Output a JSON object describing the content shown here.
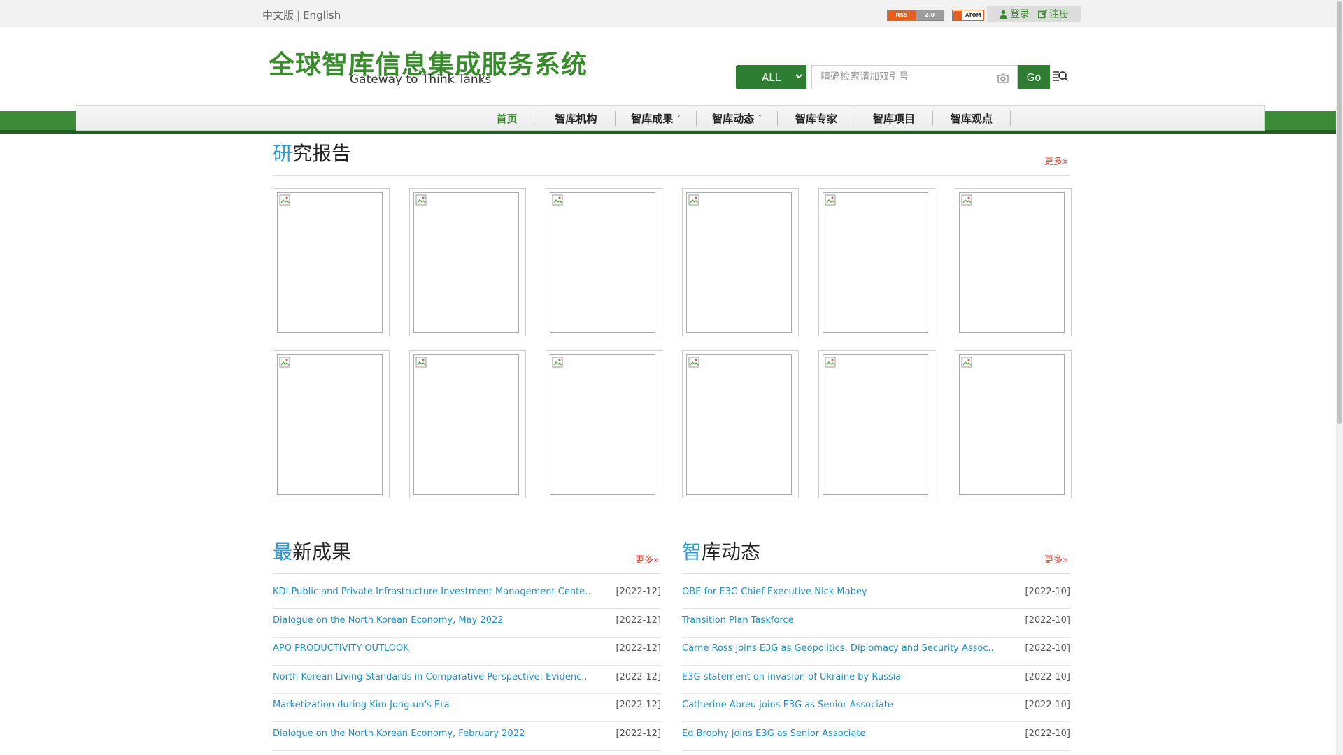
{
  "topbar": {
    "lang_cn": "中文版",
    "lang_sep": "|",
    "lang_en": "English",
    "rss_left": "RSS",
    "rss_right": "2.0",
    "atom_label": "ATOM",
    "login_label": "登录",
    "register_label": "注册"
  },
  "header": {
    "logo_cn": "全球智库信息集成服务系统",
    "logo_en": "Gateway to Think Tanks",
    "search": {
      "scope_value": "ALL",
      "placeholder": "精确检索请加双引号",
      "go_label": "Go"
    }
  },
  "nav": {
    "items": [
      {
        "label": "首页",
        "active": true,
        "dropdown": false
      },
      {
        "label": "智库机构",
        "active": false,
        "dropdown": false
      },
      {
        "label": "智库成果",
        "active": false,
        "dropdown": true
      },
      {
        "label": "智库动态",
        "active": false,
        "dropdown": true
      },
      {
        "label": "智库专家",
        "active": false,
        "dropdown": false
      },
      {
        "label": "智库项目",
        "active": false,
        "dropdown": false
      },
      {
        "label": "智库观点",
        "active": false,
        "dropdown": false
      }
    ],
    "caret": "˅"
  },
  "reports": {
    "title_first": "研",
    "title_rest": "究报告",
    "more": "更多»"
  },
  "latest": {
    "title_first": "最",
    "title_rest": "新成果",
    "more": "更多»",
    "items": [
      {
        "title": "KDI Public and Private Infrastructure Investment Management Cente..",
        "date": "[2022-12]"
      },
      {
        "title": "Dialogue on the North Korean Economy, May 2022",
        "date": "[2022-12]"
      },
      {
        "title": "APO PRODUCTIVITY OUTLOOK",
        "date": "[2022-12]"
      },
      {
        "title": "North Korean Living Standards in Comparative Perspective: Evidenc..",
        "date": "[2022-12]"
      },
      {
        "title": "Marketization during Kim Jong-un's Era",
        "date": "[2022-12]"
      },
      {
        "title": "Dialogue on the North Korean Economy, February 2022",
        "date": "[2022-12]"
      }
    ]
  },
  "dynamics": {
    "title_first": "智",
    "title_rest": "库动态",
    "more": "更多»",
    "items": [
      {
        "title": "OBE for E3G Chief Executive Nick Mabey",
        "date": "[2022-10]"
      },
      {
        "title": "Transition Plan Taskforce",
        "date": "[2022-10]"
      },
      {
        "title": "Carne Ross joins E3G as Geopolitics, Diplomacy and Security Assoc..",
        "date": "[2022-10]"
      },
      {
        "title": "E3G statement on invasion of Ukraine by Russia",
        "date": "[2022-10]"
      },
      {
        "title": "Catherine Abreu joins E3G as Senior Associate",
        "date": "[2022-10]"
      },
      {
        "title": "Ed Brophy joins E3G as Senior Associate",
        "date": "[2022-10]"
      }
    ]
  },
  "colors": {
    "brand_green": "#3a8a2e",
    "dark_green": "#2e7d32",
    "link_blue": "#1e8fc9",
    "accent_blue": "#2a9ad6",
    "more_red": "#e03a2d"
  }
}
